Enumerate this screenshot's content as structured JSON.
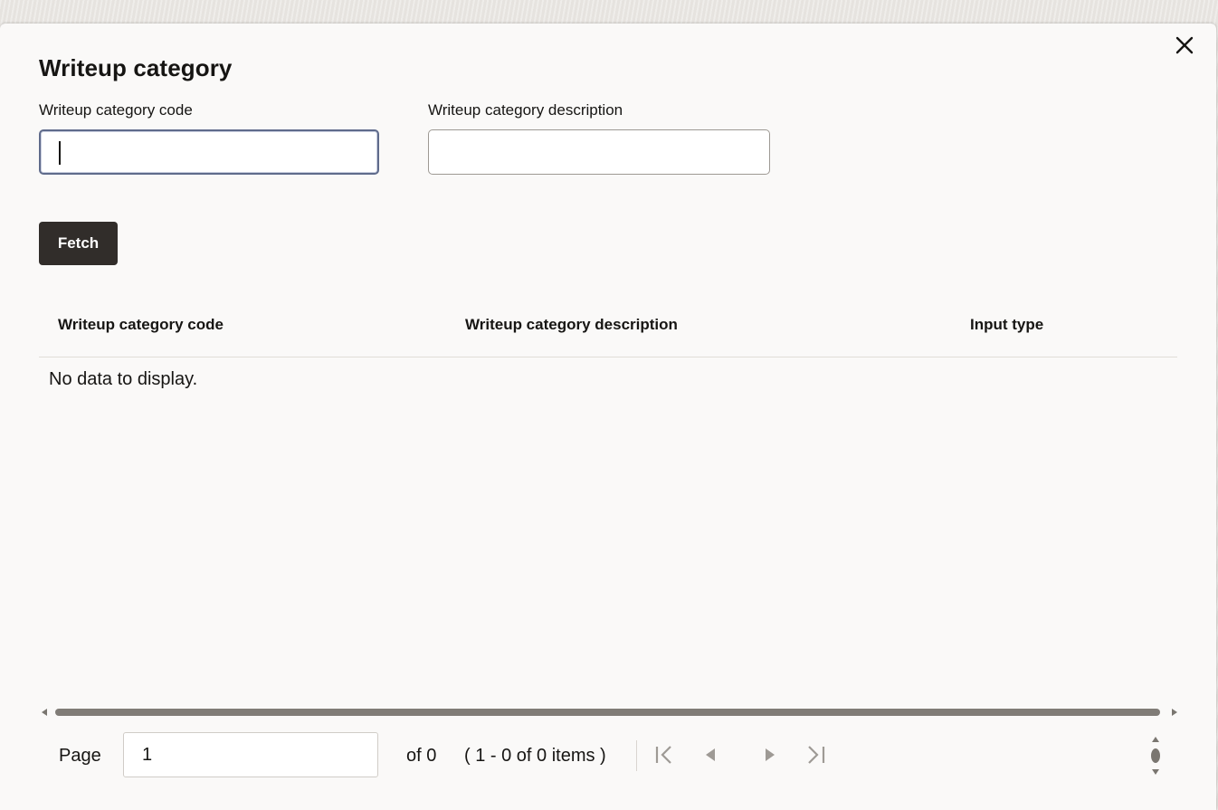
{
  "dialog": {
    "title": "Writeup category",
    "close_label": "close"
  },
  "search": {
    "code_label": "Writeup category code",
    "code_value": "",
    "description_label": "Writeup category description",
    "description_value": ""
  },
  "actions": {
    "fetch_label": "Fetch"
  },
  "table": {
    "columns": [
      "Writeup category code",
      "Writeup category description",
      "Input type"
    ],
    "empty_message": "No data to display.",
    "rows": []
  },
  "pagination": {
    "page_label": "Page",
    "page_value": "1",
    "of_total": "of 0",
    "range_text": "( 1 - 0 of 0 items )",
    "icons": [
      "first-page-icon",
      "previous-page-icon",
      "next-page-icon",
      "last-page-icon",
      "more-options-icon"
    ]
  },
  "colors": {
    "dialog_background": "#faf9f8",
    "primary_button": "#312d2a",
    "focus_border": "#5f6b8b",
    "icon_disabled": "#9e9a95"
  }
}
